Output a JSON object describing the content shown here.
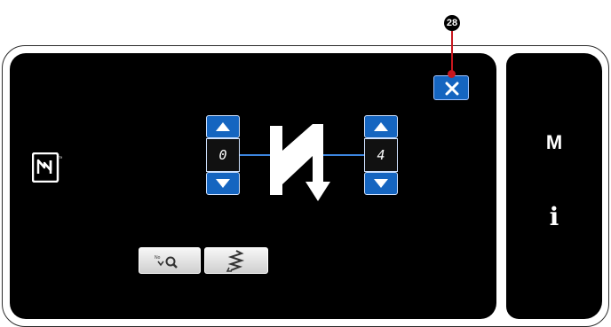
{
  "callout": {
    "number": "28"
  },
  "close_button": {
    "icon": "close-icon",
    "color": "#1565c0"
  },
  "nfc": {
    "icon": "nfc-icon"
  },
  "left_stepper": {
    "value": "0",
    "up_icon": "arrow-up-icon",
    "down_icon": "arrow-down-icon"
  },
  "right_stepper": {
    "value": "4",
    "up_icon": "arrow-up-icon",
    "down_icon": "arrow-down-icon"
  },
  "pattern": {
    "icon": "stitch-pattern-icon"
  },
  "toolbar": {
    "buttons": [
      {
        "icon": "search-icon"
      },
      {
        "icon": "zigzag-stitch-icon"
      }
    ]
  },
  "side_panel": {
    "mode_label": "M",
    "info_label": "i"
  }
}
